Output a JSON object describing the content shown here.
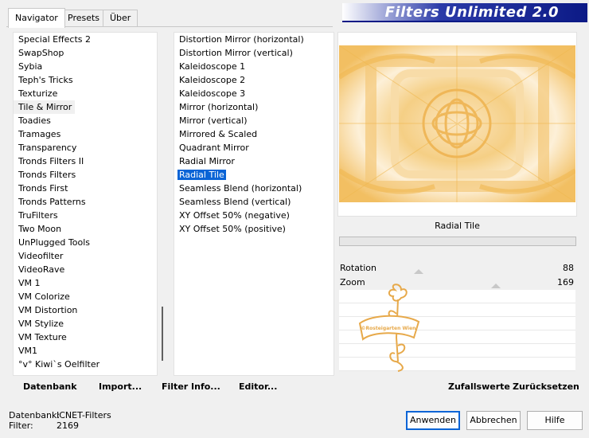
{
  "tabs": [
    "Navigator",
    "Presets",
    "Über"
  ],
  "app_title": "Filters Unlimited 2.0",
  "categories": [
    "Special Effects 2",
    "SwapShop",
    "Sybia",
    "Teph's Tricks",
    "Texturize",
    "Tile & Mirror",
    "Toadies",
    "Tramages",
    "Transparency",
    "Tronds Filters II",
    "Tronds Filters",
    "Tronds First",
    "Tronds Patterns",
    "TruFilters",
    "Two Moon",
    "UnPlugged Tools",
    "Videofilter",
    "VideoRave",
    "VM 1",
    "VM Colorize",
    "VM Distortion",
    "VM Stylize",
    "VM Texture",
    "VM1",
    "°v° Kiwi`s Oelfilter"
  ],
  "selected_category": "Tile & Mirror",
  "filters": [
    "Distortion Mirror (horizontal)",
    "Distortion Mirror (vertical)",
    "Kaleidoscope 1",
    "Kaleidoscope 2",
    "Kaleidoscope 3",
    "Mirror (horizontal)",
    "Mirror (vertical)",
    "Mirrored & Scaled",
    "Quadrant Mirror",
    "Radial Mirror",
    "Radial Tile",
    "Seamless Blend (horizontal)",
    "Seamless Blend (vertical)",
    "XY Offset 50% (negative)",
    "XY Offset 50% (positive)"
  ],
  "selected_filter": "Radial Tile",
  "current_filter_name": "Radial Tile",
  "params": [
    {
      "label": "Rotation",
      "value": "88"
    },
    {
      "label": "Zoom",
      "value": "169"
    }
  ],
  "watermark": "©Rosteigarten Wien",
  "toolbar": {
    "datenbank": "Datenbank",
    "import": "Import...",
    "filter_info": "Filter Info...",
    "editor": "Editor...",
    "zufallswerte": "Zufallswerte",
    "zuruecksetzen": "Zurücksetzen"
  },
  "status": {
    "db_label": "Datenbank:",
    "db_value": "ICNET-Filters",
    "filter_label": "Filter:",
    "filter_value": "2169"
  },
  "buttons": {
    "apply": "Anwenden",
    "cancel": "Abbrechen",
    "help": "Hilfe"
  },
  "colors": {
    "selection_blue": "#0a64d6",
    "banner_blue": "#0c1a86",
    "preview_gold": "#f0b850"
  }
}
